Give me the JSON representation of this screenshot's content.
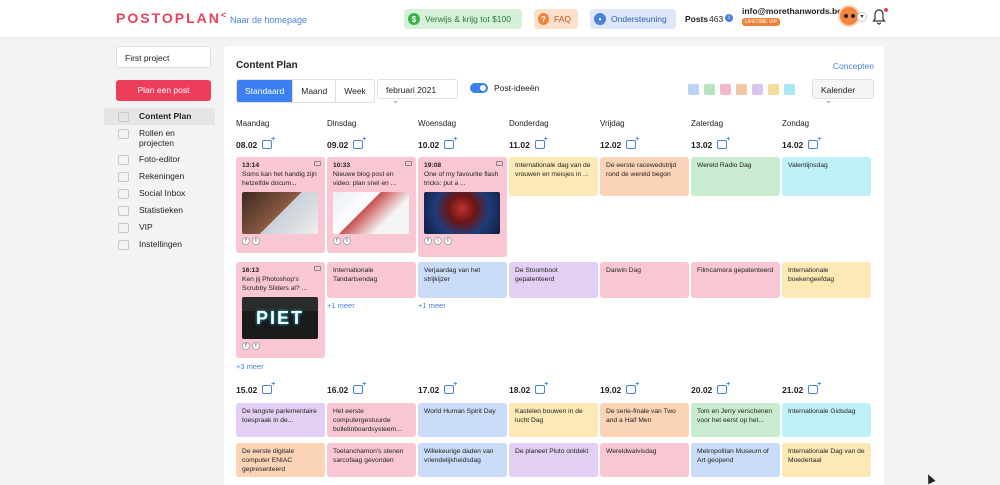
{
  "header": {
    "logo": "POSTOPLAN",
    "home_link": "Naar de homepage",
    "refer": "Verwijs & krijg tot $100",
    "faq": "FAQ",
    "support": "Ondersteuning",
    "posts_label": "Posts",
    "posts_count": "463",
    "email": "info@morethanwords.be",
    "badge": "LIFETIME VIP"
  },
  "sidebar": {
    "project": "First project",
    "plan_button": "Plan een post",
    "items": [
      "Content Plan",
      "Rollen en projecten",
      "Foto-editor",
      "Rekeningen",
      "Social Inbox",
      "Statistieken",
      "VIP",
      "Instellingen"
    ]
  },
  "main": {
    "title": "Content Plan",
    "concepten": "Concepten",
    "views": [
      "Standaard",
      "Maand",
      "Week"
    ],
    "month": "februari 2021",
    "toggle_label": "Post-ideeën",
    "calendar_select": "Kalender",
    "swatch_colors": [
      "#cadcf8",
      "#c9ecd0",
      "#f9c6d4",
      "#fbd3b6",
      "#e2cff3",
      "#fce9b6",
      "#bff0f8"
    ],
    "days": [
      "Maandag",
      "Dinsdag",
      "Woensdag",
      "Donderdag",
      "Vrijdag",
      "Zaterdag",
      "Zondag"
    ],
    "week1_dates": [
      "08.02",
      "09.02",
      "10.02",
      "11.02",
      "12.02",
      "13.02",
      "14.02"
    ],
    "week2_dates": [
      "15.02",
      "16.02",
      "17.02",
      "18.02",
      "19.02",
      "20.02",
      "21.02"
    ]
  },
  "events": {
    "w1r1": [
      {
        "time": "13:14",
        "text": "Soms kan het handig zijn hetzelfde docum..."
      },
      {
        "time": "10:33",
        "text": "Nieuwe blog post en video: plan snel en ..."
      },
      {
        "time": "19:08",
        "text": "One of my favourite flash tricks: put a ..."
      },
      {
        "text": "Internationale dag van de vrouwen en meisjes in ..."
      },
      {
        "text": "De eerste racewedstrijd rond de wereld begon"
      },
      {
        "text": "Wereld Radio Dag"
      },
      {
        "text": "Valentijnsdag"
      }
    ],
    "w1r2": [
      {
        "time": "16:13",
        "text": "Ken jij Photoshop's Scrubby Sliders al? ..."
      },
      {
        "text": "Internationale Tandartsendag"
      },
      {
        "text": "Verjaardag van het strijkijzer"
      },
      {
        "text": "De Stoomboot gepatenteerd"
      },
      {
        "text": "Darwin Dag"
      },
      {
        "text": "Filmcamera gepatenteerd"
      },
      {
        "text": "Internationale boekengeefdag"
      }
    ],
    "more": [
      "+3 meer",
      "+1 meer",
      "+1 meer"
    ],
    "image_text": "PIET",
    "w2r1": [
      {
        "text": "De langste parlementaire toespraak in de..."
      },
      {
        "text": "Het eerste computergestuurde bulletinboardsysteem..."
      },
      {
        "text": "World Human Spirit Day"
      },
      {
        "text": "Kastelen bouwen in de lucht Dag"
      },
      {
        "text": "De serie-finale van Two and a Half Men"
      },
      {
        "text": "Tom en Jerry verschenen voor het eerst op het..."
      },
      {
        "text": "Internationale Gidsdag"
      }
    ],
    "w2r2": [
      {
        "text": "De eerste digitale computer ENIAC gepresenteerd"
      },
      {
        "text": "Toetanchamon's stenen sarcofaag gevonden"
      },
      {
        "text": "Willekeurige daden van vriendelijkheidsdag"
      },
      {
        "text": "De planeet Pluto ontdekt"
      },
      {
        "text": "Wereldwalvisdag"
      },
      {
        "text": "Metropolitan Museum of Art geopend"
      },
      {
        "text": "Internationale Dag van de Moedertaal"
      }
    ]
  }
}
